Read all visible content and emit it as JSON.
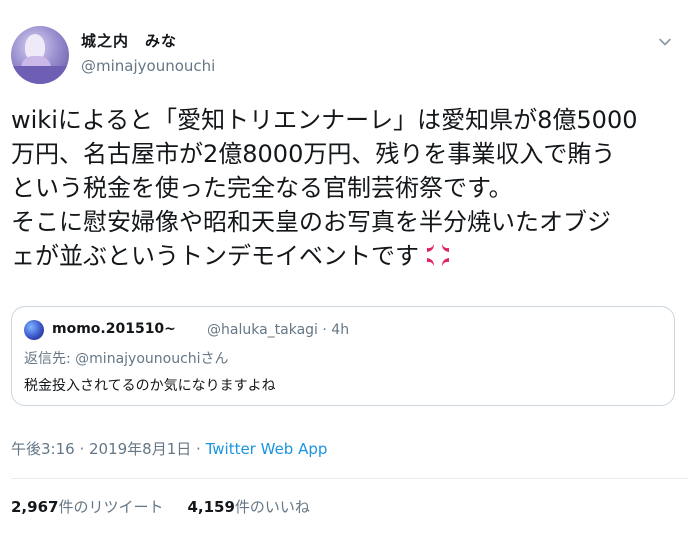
{
  "author": {
    "display_name": "城之内　みな",
    "handle": "@minajyounouchi"
  },
  "tweet": {
    "text": "wikiによると「愛知トリエンナーレ」は愛知県が8億5000\n万円、名古屋市が2億8000万円、残りを事業収入で賄う\nという税金を使った完全なる官制芸術祭です。\nそこに慰安婦像や昭和天皇のお写真を半分焼いたオブジ\nェが並ぶというトンデモイベントです",
    "emoji_icon": "anger-symbol-icon"
  },
  "quoted": {
    "name": "momo.201510~",
    "handle_time": "@haluka_takagi · 4h",
    "reply_prefix": "返信先: ",
    "reply_to": "@minajyounouchi",
    "reply_suffix": "さん",
    "text": "税金投入されてるのか気になりますよね"
  },
  "meta": {
    "time": "午後3:16",
    "sep1": " · ",
    "date": "2019年8月1日",
    "sep2": " · ",
    "source": "Twitter Web App"
  },
  "stats": {
    "retweets": "2,967",
    "retweets_label": "件のリツイート",
    "likes": "4,159",
    "likes_label": "件のいいね"
  },
  "colors": {
    "accent": "#1b95e0",
    "secondary": "#657786",
    "anger": "#e0245e"
  }
}
